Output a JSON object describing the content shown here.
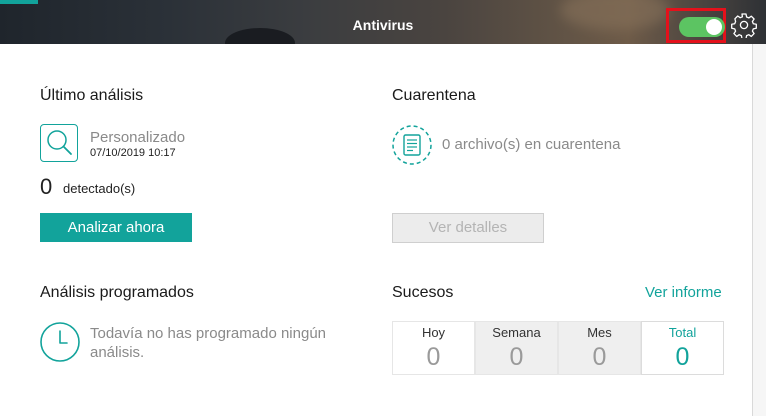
{
  "header": {
    "title": "Antivirus",
    "toggle_on": true,
    "accent_color": "#12a39b",
    "toggle_color": "#5cc462",
    "highlight_color": "#e4111b"
  },
  "last_scan": {
    "heading": "Último análisis",
    "type": "Personalizado",
    "date": "07/10/2019 10:17",
    "detected_count": "0",
    "detected_label": "detectado(s)",
    "button": "Analizar ahora"
  },
  "quarantine": {
    "heading": "Cuarentena",
    "summary": "0 archivo(s) en cuarentena",
    "button": "Ver detalles"
  },
  "scheduled": {
    "heading": "Análisis programados",
    "message_line1": "Todavía no has programado ningún",
    "message_line2": "análisis."
  },
  "events": {
    "heading": "Sucesos",
    "report_link": "Ver informe",
    "stats": [
      {
        "label": "Hoy",
        "value": "0"
      },
      {
        "label": "Semana",
        "value": "0"
      },
      {
        "label": "Mes",
        "value": "0"
      },
      {
        "label": "Total",
        "value": "0"
      }
    ]
  }
}
